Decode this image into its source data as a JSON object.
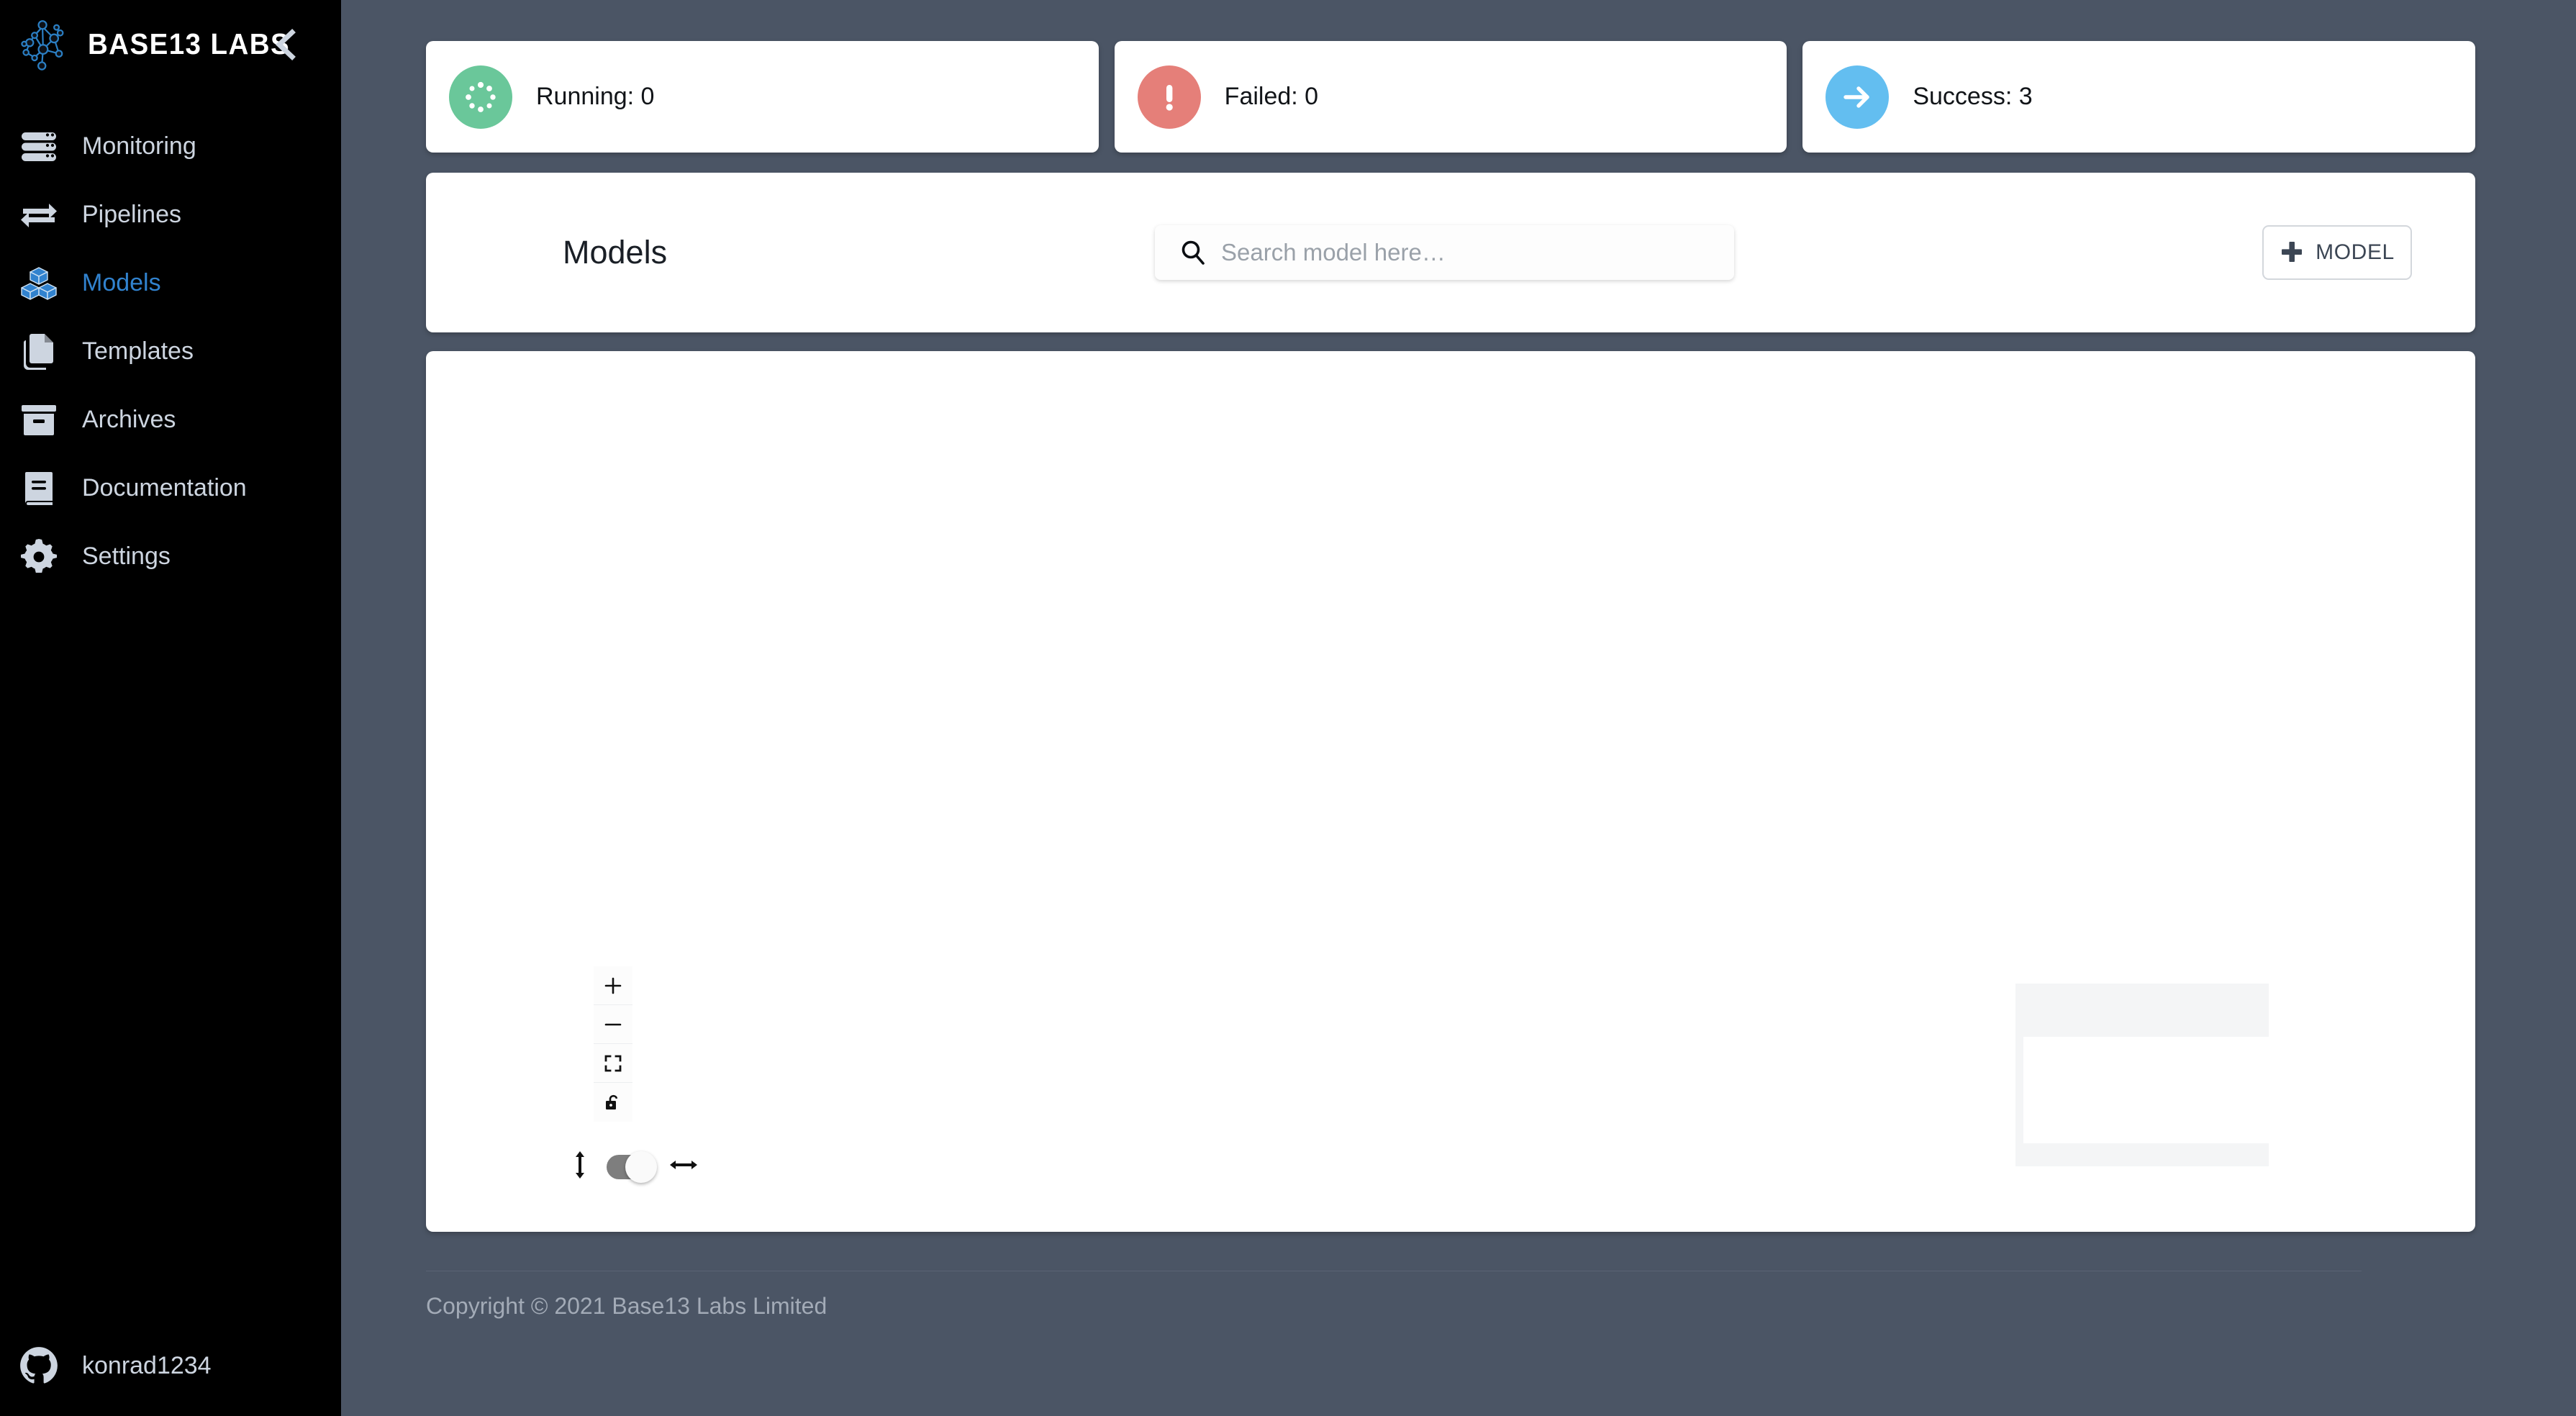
{
  "brand": {
    "name": "BASE13 LABS",
    "logo_icon": "network-graph-logo",
    "collapse_icon": "chevron-left-icon"
  },
  "sidebar": {
    "items": [
      {
        "label": "Monitoring",
        "icon": "server-rack-icon",
        "active": false
      },
      {
        "label": "Pipelines",
        "icon": "exchange-arrows-icon",
        "active": false
      },
      {
        "label": "Models",
        "icon": "cubes-icon",
        "active": true
      },
      {
        "label": "Templates",
        "icon": "copy-documents-icon",
        "active": false
      },
      {
        "label": "Archives",
        "icon": "archive-box-icon",
        "active": false
      },
      {
        "label": "Documentation",
        "icon": "book-icon",
        "active": false
      },
      {
        "label": "Settings",
        "icon": "gear-icon",
        "active": false
      }
    ],
    "user": {
      "name": "konrad1234",
      "avatar_icon": "github-icon"
    }
  },
  "status_cards": [
    {
      "label": "Running: 0",
      "icon": "spinner-dots-icon",
      "color": "#6ac79a"
    },
    {
      "label": "Failed: 0",
      "icon": "exclamation-circle-icon",
      "color": "#e57f79"
    },
    {
      "label": "Success: 3",
      "icon": "arrow-right-icon",
      "color": "#63bef0"
    }
  ],
  "toolbar": {
    "title": "Models",
    "search": {
      "value": "",
      "placeholder": "Search model here…",
      "icon": "search-icon"
    },
    "add_button": {
      "label": "MODEL",
      "icon": "plus-icon"
    }
  },
  "canvas": {
    "controls": [
      {
        "name": "zoom-in",
        "icon": "plus-icon",
        "glyph": "+"
      },
      {
        "name": "zoom-out",
        "icon": "minus-icon",
        "glyph": "−"
      },
      {
        "name": "fit-view",
        "icon": "fit-screen-icon",
        "glyph": ""
      },
      {
        "name": "lock",
        "icon": "unlock-icon",
        "glyph": ""
      }
    ],
    "orientation_toggle": {
      "vertical_icon": "arrows-vertical-icon",
      "horizontal_icon": "arrows-horizontal-icon",
      "state": "horizontal"
    },
    "minimap": {
      "name": "minimap"
    },
    "nodes": []
  },
  "footer": {
    "copyright": "Copyright © 2021 Base13 Labs Limited"
  },
  "colors": {
    "page_background": "#4b5565",
    "sidebar_background": "#000000",
    "accent_blue": "#3182ce",
    "running_green": "#6ac79a",
    "failed_red": "#e57f79",
    "success_blue": "#63bef0"
  }
}
